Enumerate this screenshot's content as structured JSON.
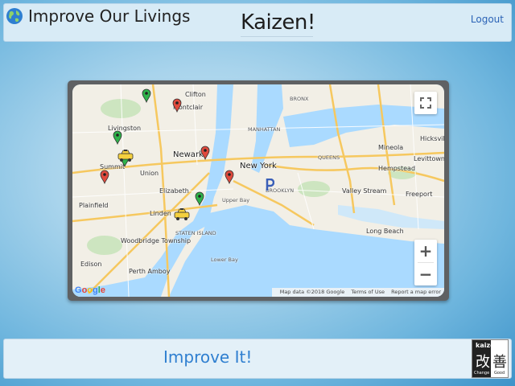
{
  "header": {
    "brand": "Improve Our Livings",
    "title": "Kaizen!",
    "logout": "Logout"
  },
  "map": {
    "places": [
      {
        "name": "Clifton",
        "cls": ""
      },
      {
        "name": "Montclair",
        "cls": ""
      },
      {
        "name": "Livingston",
        "cls": ""
      },
      {
        "name": "Newark",
        "cls": "big"
      },
      {
        "name": "Union",
        "cls": ""
      },
      {
        "name": "Summit",
        "cls": ""
      },
      {
        "name": "Elizabeth",
        "cls": ""
      },
      {
        "name": "Plainfield",
        "cls": ""
      },
      {
        "name": "Linden",
        "cls": ""
      },
      {
        "name": "STATEN ISLAND",
        "cls": "small"
      },
      {
        "name": "Woodbridge Township",
        "cls": ""
      },
      {
        "name": "Edison",
        "cls": ""
      },
      {
        "name": "Perth Amboy",
        "cls": ""
      },
      {
        "name": "New York",
        "cls": "big"
      },
      {
        "name": "MANHATTAN",
        "cls": "small"
      },
      {
        "name": "BRONX",
        "cls": "small"
      },
      {
        "name": "QUEENS",
        "cls": "small"
      },
      {
        "name": "BROOKLYN",
        "cls": "small"
      },
      {
        "name": "Mineola",
        "cls": ""
      },
      {
        "name": "Hempstead",
        "cls": ""
      },
      {
        "name": "Hicksville",
        "cls": ""
      },
      {
        "name": "Levittown",
        "cls": ""
      },
      {
        "name": "Freeport",
        "cls": ""
      },
      {
        "name": "Valley Stream",
        "cls": ""
      },
      {
        "name": "Long Beach",
        "cls": ""
      },
      {
        "name": "Upper Bay",
        "cls": "small"
      },
      {
        "name": "Lower Bay",
        "cls": "small"
      }
    ],
    "markers": [
      {
        "kind": "pin",
        "color": "#2fb24a"
      },
      {
        "kind": "pin",
        "color": "#e04a3d"
      },
      {
        "kind": "pin",
        "color": "#2fb24a"
      },
      {
        "kind": "pin",
        "color": "#2fb24a"
      },
      {
        "kind": "pin",
        "color": "#e04a3d"
      },
      {
        "kind": "pin",
        "color": "#e04a3d"
      },
      {
        "kind": "pin",
        "color": "#e04a3d"
      },
      {
        "kind": "pin",
        "color": "#2fb24a"
      },
      {
        "kind": "taxi",
        "color": "#f4d03f"
      },
      {
        "kind": "taxi",
        "color": "#f4d03f"
      },
      {
        "kind": "parking",
        "color": "#3a5fb8"
      }
    ],
    "zoom_in": "+",
    "zoom_out": "−",
    "attribution": {
      "map_data": "Map data ©2018 Google",
      "terms": "Terms of Use",
      "report": "Report a map error"
    },
    "logo": "Google"
  },
  "footer": {
    "improve_button": "Improve It!",
    "logo_word": "kaizen",
    "logo_glyph_left": "改",
    "logo_glyph_right": "善",
    "logo_sub_left": "Change",
    "logo_sub_right": "Good"
  },
  "colors": {
    "accent": "#2f7fd0",
    "link": "#2b63b6",
    "water": "#aadaff",
    "land": "#f2efe6"
  }
}
